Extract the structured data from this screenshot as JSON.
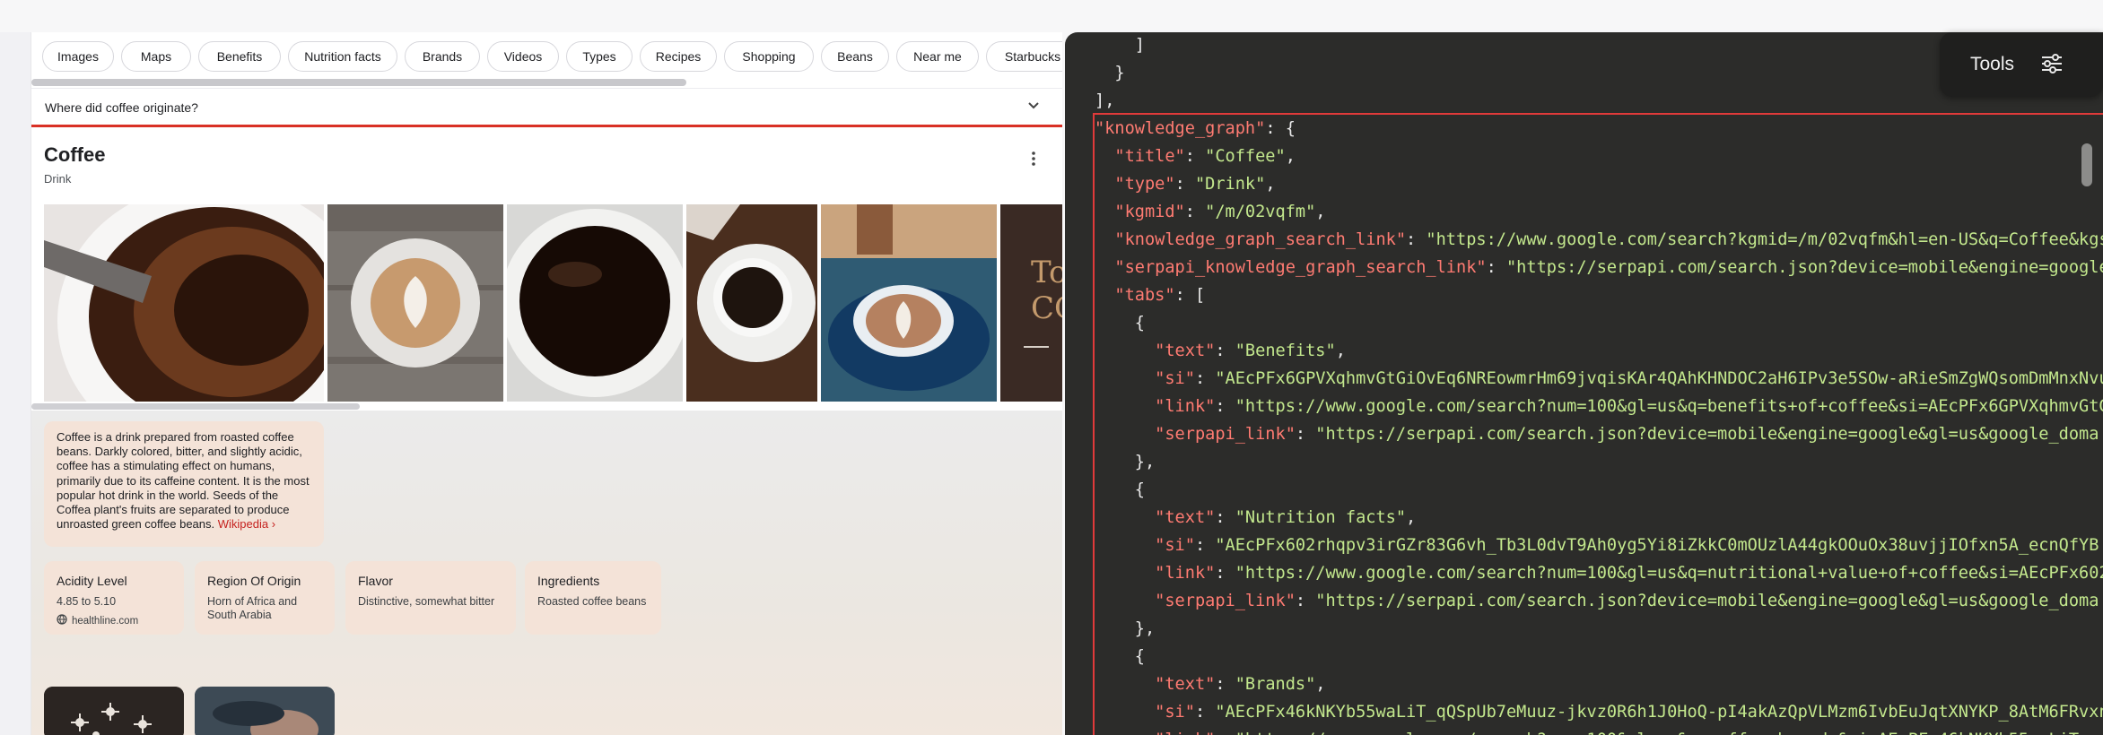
{
  "serp": {
    "chips": [
      "Images",
      "Maps",
      "Benefits",
      "Nutrition facts",
      "Brands",
      "Videos",
      "Types",
      "Recipes",
      "Shopping",
      "Beans",
      "Near me",
      "Starbucks"
    ],
    "faq_question": "Where did coffee originate?",
    "kp_title": "Coffee",
    "kp_type": "Drink",
    "description": "Coffee is a drink prepared from roasted coffee beans. Darkly colored, bitter, and slightly acidic, coffee has a stimulating effect on humans, primarily due to its caffeine content. It is the most popular hot drink in the world. Seeds of the Coffea plant's fruits are separated to produce unroasted green coffee beans.",
    "description_link": "Wikipedia",
    "facts": [
      {
        "title": "Acidity Level",
        "value": "4.85 to 5.10",
        "source": "healthline.com"
      },
      {
        "title": "Region Of Origin",
        "value": "Horn of Africa and South Arabia"
      },
      {
        "title": "Flavor",
        "value": "Distinctive, somewhat bitter"
      },
      {
        "title": "Ingredients",
        "value": "Roasted coffee beans"
      }
    ],
    "gallery_partial_text": "To\nCO"
  },
  "json_viewer": {
    "lines": [
      {
        "t": "    ]"
      },
      {
        "t": "  }"
      },
      {
        "t": "],"
      },
      {
        "k": "\"knowledge_graph\"",
        "t": ": {"
      },
      {
        "k": "  \"title\"",
        "t": ": ",
        "s": "\"Coffee\"",
        "e": ","
      },
      {
        "k": "  \"type\"",
        "t": ": ",
        "s": "\"Drink\"",
        "e": ","
      },
      {
        "k": "  \"kgmid\"",
        "t": ": ",
        "s": "\"/m/02vqfm\"",
        "e": ","
      },
      {
        "k": "  \"knowledge_graph_search_link\"",
        "t": ": ",
        "s": "\"https://www.google.com/search?kgmid=/m/02vqfm&hl=en-US&q=Coffee&kgs"
      },
      {
        "k": "  \"serpapi_knowledge_graph_search_link\"",
        "t": ": ",
        "s": "\"https://serpapi.com/search.json?device=mobile&engine=google"
      },
      {
        "k": "  \"tabs\"",
        "t": ": ["
      },
      {
        "t": "    {"
      },
      {
        "k": "      \"text\"",
        "t": ": ",
        "s": "\"Benefits\"",
        "e": ","
      },
      {
        "k": "      \"si\"",
        "t": ": ",
        "s": "\"AEcPFx6GPVXqhmvGtGiOvEq6NREowmrHm69jvqisKAr4QAhKHNDOC2aH6IPv3e5SOw-aRieSmZgWQsomDmMnxNvu"
      },
      {
        "k": "      \"link\"",
        "t": ": ",
        "s": "\"https://www.google.com/search?num=100&gl=us&q=benefits+of+coffee&si=AEcPFx6GPVXqhmvGtG"
      },
      {
        "k": "      \"serpapi_link\"",
        "t": ": ",
        "s": "\"https://serpapi.com/search.json?device=mobile&engine=google&gl=us&google_doma"
      },
      {
        "t": "    },"
      },
      {
        "t": "    {"
      },
      {
        "k": "      \"text\"",
        "t": ": ",
        "s": "\"Nutrition facts\"",
        "e": ","
      },
      {
        "k": "      \"si\"",
        "t": ": ",
        "s": "\"AEcPFx602rhqpv3irGZr83G6vh_Tb3L0dvT9Ah0yg5Yi8iZkkC0mOUzlA44gkOOuOx38uvjjIOfxn5A_ecnQfYB"
      },
      {
        "k": "      \"link\"",
        "t": ": ",
        "s": "\"https://www.google.com/search?num=100&gl=us&q=nutritional+value+of+coffee&si=AEcPFx602"
      },
      {
        "k": "      \"serpapi_link\"",
        "t": ": ",
        "s": "\"https://serpapi.com/search.json?device=mobile&engine=google&gl=us&google_doma"
      },
      {
        "t": "    },"
      },
      {
        "t": "    {"
      },
      {
        "k": "      \"text\"",
        "t": ": ",
        "s": "\"Brands\"",
        "e": ","
      },
      {
        "k": "      \"si\"",
        "t": ": ",
        "s": "\"AEcPFx46kNKYb55waLiT_qQSpUb7eMuuz-jkvz0R6h1J0HoQ-pI4akAzQpVLMzm6IvbEuJqtXNYKP_8AtM6FRvxn"
      },
      {
        "k": "      \"link\"",
        "t": ": ",
        "s": "\"https://www.google.com/search?num=100&gl=us&q=coffee+brands&si=AEcPFx46kNKYb55waLiT_q"
      }
    ]
  },
  "tools": {
    "label": "Tools",
    "icon": "sliders-icon"
  }
}
